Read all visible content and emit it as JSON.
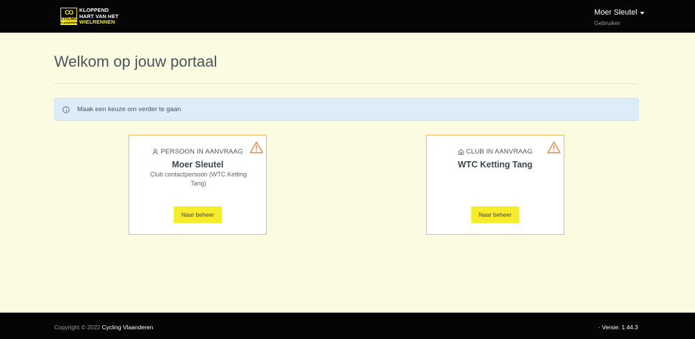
{
  "header": {
    "logo": {
      "mark_symbol": "CO",
      "mark_text": "CYCLING",
      "mark_subtext": "VLAANDEREN",
      "line1": "KLOPPEND",
      "line2": "HART VAN HET",
      "line3": "WIELRENNEN"
    },
    "user": {
      "name": "Moer Sleutel",
      "role": "Gebruiker"
    }
  },
  "main": {
    "title": "Welkom op jouw portaal",
    "alert": {
      "icon": "info-icon",
      "text": "Maak een keuze om verder te gaan"
    },
    "cards": [
      {
        "icon": "person-icon",
        "label": "PERSOON IN AANVRAAG",
        "title": "Moer Sleutel",
        "subtitle": "Club contactpersoon (WTC Ketting Tang)",
        "button": "Naar beheer",
        "status_icon": "warning-icon"
      },
      {
        "icon": "home-icon",
        "label": "CLUB IN AANVRAAG",
        "title": "WTC Ketting Tang",
        "subtitle": "",
        "button": "Naar beheer",
        "status_icon": "warning-icon"
      }
    ]
  },
  "footer": {
    "copyright_prefix": "Copyright © 2022",
    "copyright_brand": "Cycling Vlaanderen",
    "version": "· Versie: 1.44.3"
  },
  "colors": {
    "background": "#fbfbe1",
    "header": "#050505",
    "accent": "#f6ec2c",
    "card_border": "#f5b75d",
    "warning": "#e8904a",
    "alert_bg": "#dcecf8"
  }
}
